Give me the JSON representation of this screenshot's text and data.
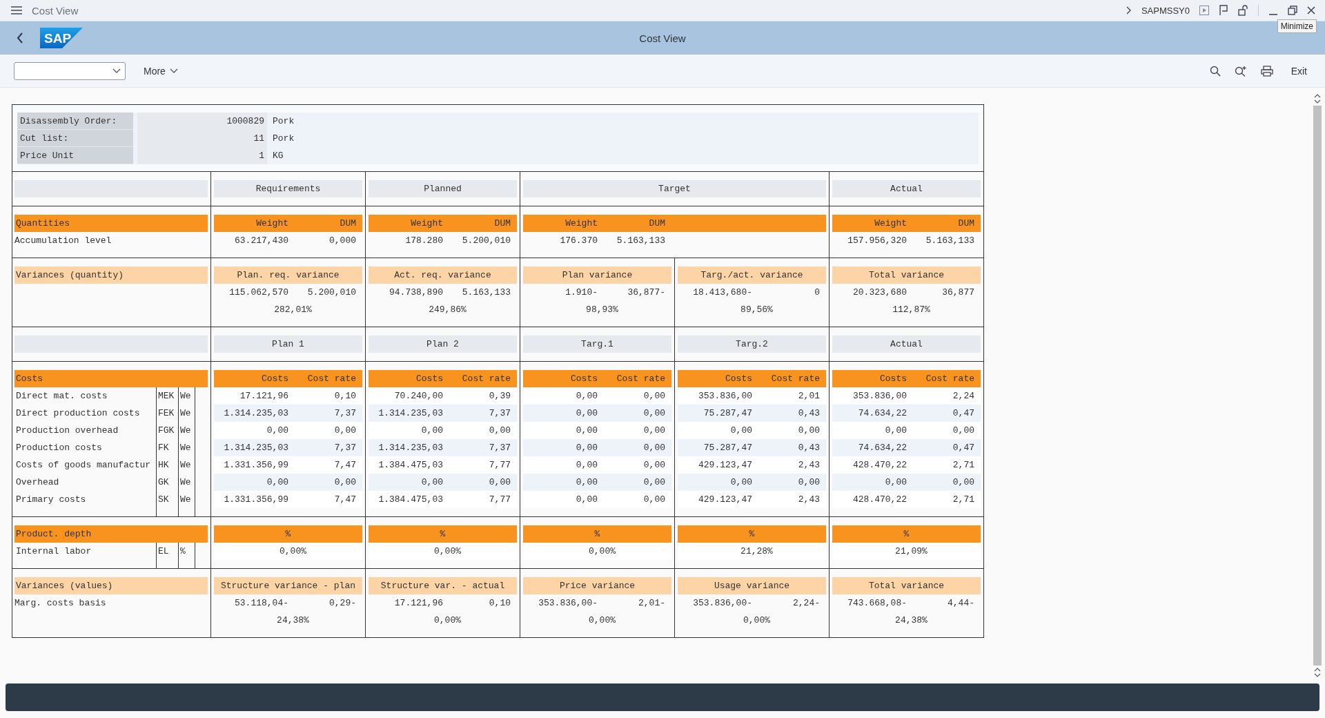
{
  "window": {
    "title": "Cost View",
    "program": "SAPMSSY0",
    "tooltip": "Minimize"
  },
  "header": {
    "logo": "SAP",
    "title": "Cost View"
  },
  "toolbar": {
    "more": "More",
    "exit": "Exit"
  },
  "info": [
    {
      "label": "Disassembly Order:",
      "value": "1000829",
      "unit": "Pork"
    },
    {
      "label": "Cut list:",
      "value": "11",
      "unit": "Pork"
    },
    {
      "label": "Price Unit",
      "value": "1",
      "unit": "KG"
    }
  ],
  "sections": [
    {
      "kind": "headings",
      "columns": [
        {
          "text": "Requirements",
          "wide": false
        },
        {
          "text": "Planned",
          "wide": false
        },
        {
          "text": "Target",
          "wide": true
        },
        {
          "text": "Actual",
          "wide": false
        }
      ]
    },
    {
      "kind": "quantities",
      "title": "Quantities",
      "row_label": "Accumulation level",
      "columns": [
        {
          "wide": false,
          "headers": [
            "Weight",
            "DUM"
          ],
          "values": [
            "63.217,430",
            "0,000"
          ]
        },
        {
          "wide": false,
          "headers": [
            "Weight",
            "DUM"
          ],
          "values": [
            "178.280",
            "5.200,010"
          ]
        },
        {
          "wide": true,
          "headers": [
            "Weight",
            "DUM"
          ],
          "values": [
            "176.370",
            "5.163,133"
          ]
        },
        {
          "wide": false,
          "headers": [
            "Weight",
            "DUM"
          ],
          "values": [
            "157.956,320",
            "5.163,133"
          ]
        }
      ]
    },
    {
      "kind": "variances",
      "title": "Variances (quantity)",
      "columns": [
        {
          "header": "Plan. req. variance",
          "values": [
            "115.062,570",
            "5.200,010"
          ],
          "percent": "282,01%"
        },
        {
          "header": "Act. req. variance",
          "values": [
            "94.738,890",
            "5.163,133"
          ],
          "percent": "249,86%"
        },
        {
          "header": "Plan variance",
          "values": [
            "1.910-",
            "36,877-"
          ],
          "percent": "98,93%"
        },
        {
          "header": "Targ./act. variance",
          "values": [
            "18.413,680-",
            "0"
          ],
          "percent": "89,56%"
        },
        {
          "header": "Total variance",
          "values": [
            "20.323,680",
            "36,877"
          ],
          "percent": "112,87%"
        }
      ]
    },
    {
      "kind": "headings",
      "columns": [
        {
          "text": "Plan 1",
          "wide": false
        },
        {
          "text": "Plan 2",
          "wide": false
        },
        {
          "text": "Targ.1",
          "wide": false
        },
        {
          "text": "Targ.2",
          "wide": false
        },
        {
          "text": "Actual",
          "wide": false
        }
      ]
    },
    {
      "kind": "costs",
      "title": "Costs",
      "headers": [
        [
          "Costs",
          "Cost rate"
        ],
        [
          "Costs",
          "Cost rate"
        ],
        [
          "Costs",
          "Cost rate"
        ],
        [
          "Costs",
          "Cost rate"
        ],
        [
          "Costs",
          "Cost rate"
        ]
      ],
      "rows": [
        {
          "label": "Direct mat. costs",
          "code": "MEK",
          "unit": "We",
          "values": [
            [
              "17.121,96",
              "0,10"
            ],
            [
              "70.240,00",
              "0,39"
            ],
            [
              "0,00",
              "0,00"
            ],
            [
              "353.836,00",
              "2,01"
            ],
            [
              "353.836,00",
              "2,24"
            ]
          ]
        },
        {
          "label": "Direct production costs",
          "code": "FEK",
          "unit": "We",
          "values": [
            [
              "1.314.235,03",
              "7,37"
            ],
            [
              "1.314.235,03",
              "7,37"
            ],
            [
              "0,00",
              "0,00"
            ],
            [
              "75.287,47",
              "0,43"
            ],
            [
              "74.634,22",
              "0,47"
            ]
          ]
        },
        {
          "label": "Production overhead",
          "code": "FGK",
          "unit": "We",
          "values": [
            [
              "0,00",
              "0,00"
            ],
            [
              "0,00",
              "0,00"
            ],
            [
              "0,00",
              "0,00"
            ],
            [
              "0,00",
              "0,00"
            ],
            [
              "0,00",
              "0,00"
            ]
          ]
        },
        {
          "label": "Production costs",
          "code": "FK",
          "unit": "We",
          "values": [
            [
              "1.314.235,03",
              "7,37"
            ],
            [
              "1.314.235,03",
              "7,37"
            ],
            [
              "0,00",
              "0,00"
            ],
            [
              "75.287,47",
              "0,43"
            ],
            [
              "74.634,22",
              "0,47"
            ]
          ]
        },
        {
          "label": "Costs of goods manufactur",
          "code": "HK",
          "unit": "We",
          "values": [
            [
              "1.331.356,99",
              "7,47"
            ],
            [
              "1.384.475,03",
              "7,77"
            ],
            [
              "0,00",
              "0,00"
            ],
            [
              "429.123,47",
              "2,43"
            ],
            [
              "428.470,22",
              "2,71"
            ]
          ]
        },
        {
          "label": "Overhead",
          "code": "GK",
          "unit": "We",
          "values": [
            [
              "0,00",
              "0,00"
            ],
            [
              "0,00",
              "0,00"
            ],
            [
              "0,00",
              "0,00"
            ],
            [
              "0,00",
              "0,00"
            ],
            [
              "0,00",
              "0,00"
            ]
          ]
        },
        {
          "label": "Primary costs",
          "code": "SK",
          "unit": "We",
          "values": [
            [
              "1.331.356,99",
              "7,47"
            ],
            [
              "1.384.475,03",
              "7,77"
            ],
            [
              "0,00",
              "0,00"
            ],
            [
              "429.123,47",
              "2,43"
            ],
            [
              "428.470,22",
              "2,71"
            ]
          ]
        }
      ]
    },
    {
      "kind": "depth",
      "title": "Product. depth",
      "headers": [
        "%",
        "%",
        "%",
        "%",
        "%"
      ],
      "rows": [
        {
          "label": "Internal labor",
          "code": "EL",
          "unit": "%",
          "values": [
            "0,00%",
            "0,00%",
            "0,00%",
            "21,28%",
            "21,09%"
          ]
        }
      ]
    },
    {
      "kind": "variances",
      "title": "Variances (values)",
      "row_label": "Marg. costs basis",
      "columns": [
        {
          "header": "Structure variance - plan",
          "values": [
            "53.118,04-",
            "0,29-"
          ],
          "percent": "24,38%"
        },
        {
          "header": "Structure var. - actual",
          "values": [
            "17.121,96",
            "0,10"
          ],
          "percent": "0,00%"
        },
        {
          "header": "Price variance",
          "values": [
            "353.836,00-",
            "2,01-"
          ],
          "percent": "0,00%"
        },
        {
          "header": "Usage variance",
          "values": [
            "353.836,00-",
            "2,24-"
          ],
          "percent": "0,00%"
        },
        {
          "header": "Total variance",
          "values": [
            "743.668,08-",
            "4,44-"
          ],
          "percent": "24,38%"
        }
      ]
    }
  ]
}
